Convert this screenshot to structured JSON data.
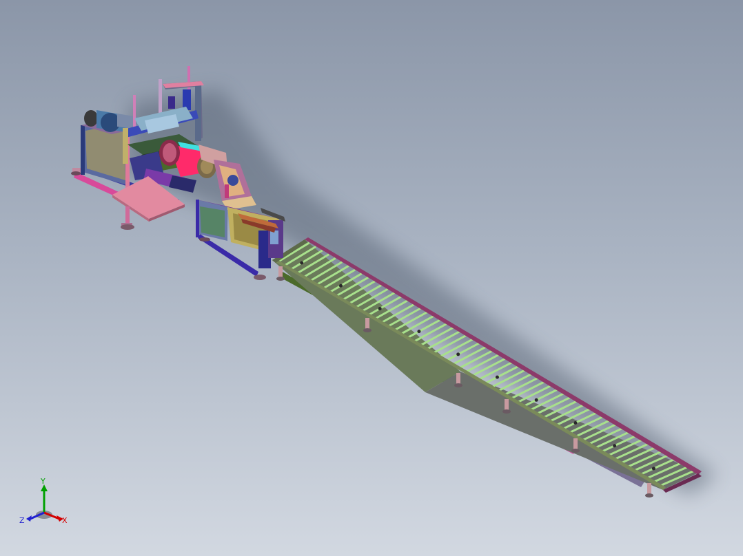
{
  "view": {
    "background_top": "#8b96a8",
    "background_bottom": "#d2d8e1"
  },
  "triad": {
    "x_label": "X",
    "y_label": "Y",
    "z_label": "Z",
    "x_color": "#d40000",
    "y_color": "#00a000",
    "z_color": "#2020d0"
  },
  "model": {
    "name": "roller-conveyor-cutting-line",
    "conveyor": {
      "roller_count": 60,
      "support_leg_count": 6,
      "roller_color": "#a8e08c",
      "rail_color": "#8c3a6a",
      "leg_color": "#c89aa0"
    },
    "machine": {
      "drum_color": "#ff2a6a",
      "table_color": "#e28aa0",
      "frame_color": "#3a3aa0"
    }
  }
}
